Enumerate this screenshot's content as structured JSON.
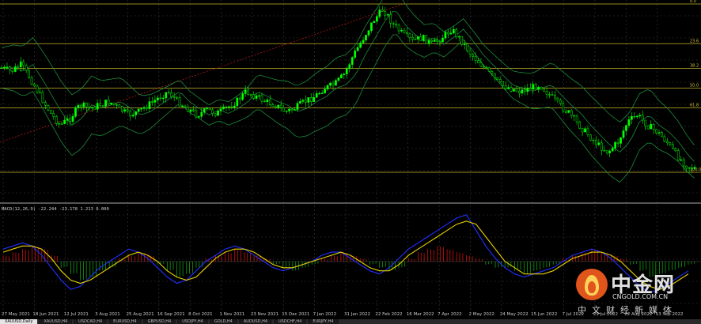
{
  "chart_data": [
    {
      "type": "candlestick",
      "title": "",
      "overlays": [
        "bollinger-bands",
        "fibonacci-retracement",
        "trend-line"
      ],
      "x_ticks": [
        "27 May 2021",
        "18 Jun 2021",
        "12 Jul 2021",
        "3 Aug 2021",
        "25 Aug 2021",
        "16 Sep 2021",
        "8 Oct 2021",
        "1 Nov 2021",
        "23 Nov 2021",
        "15 Dec 2021",
        "7 Jan 2022",
        "31 Jan 2022",
        "22 Feb 2022",
        "16 Mar 2022",
        "7 Apr 2022",
        "2 May 2022",
        "24 May 2022",
        "15 Jun 2022",
        "7 Jul 2022",
        "29 Jul 2022",
        "22 Aug 2022",
        "13 Sep 2022"
      ],
      "fib_levels": [
        {
          "label": "0.0",
          "y": 0.0
        },
        {
          "label": "23.6",
          "y": 23.6
        },
        {
          "label": "38.2",
          "y": 38.2
        },
        {
          "label": "50.0",
          "y": 50.0
        },
        {
          "label": "61.8",
          "y": 61.8
        },
        {
          "label": "100.0",
          "y": 100.0
        }
      ],
      "price_path": [
        [
          0,
          38
        ],
        [
          5,
          40
        ],
        [
          10,
          36
        ],
        [
          15,
          45
        ],
        [
          20,
          55
        ],
        [
          25,
          65
        ],
        [
          30,
          72
        ],
        [
          35,
          68
        ],
        [
          40,
          60
        ],
        [
          45,
          62
        ],
        [
          50,
          60
        ],
        [
          55,
          58
        ],
        [
          60,
          62
        ],
        [
          65,
          66
        ],
        [
          70,
          64
        ],
        [
          75,
          60
        ],
        [
          80,
          56
        ],
        [
          85,
          52
        ],
        [
          90,
          58
        ],
        [
          95,
          62
        ],
        [
          100,
          66
        ],
        [
          105,
          63
        ],
        [
          110,
          65
        ],
        [
          115,
          62
        ],
        [
          120,
          58
        ],
        [
          125,
          52
        ],
        [
          130,
          55
        ],
        [
          135,
          58
        ],
        [
          140,
          60
        ],
        [
          145,
          64
        ],
        [
          150,
          62
        ],
        [
          155,
          58
        ],
        [
          160,
          55
        ],
        [
          165,
          50
        ],
        [
          170,
          48
        ],
        [
          175,
          42
        ],
        [
          180,
          30
        ],
        [
          185,
          20
        ],
        [
          190,
          10
        ],
        [
          195,
          3
        ],
        [
          200,
          12
        ],
        [
          205,
          18
        ],
        [
          210,
          22
        ],
        [
          215,
          20
        ],
        [
          220,
          24
        ],
        [
          225,
          20
        ],
        [
          230,
          15
        ],
        [
          235,
          22
        ],
        [
          240,
          30
        ],
        [
          245,
          36
        ],
        [
          250,
          42
        ],
        [
          255,
          48
        ],
        [
          260,
          50
        ],
        [
          265,
          52
        ],
        [
          270,
          50
        ],
        [
          275,
          48
        ],
        [
          280,
          54
        ],
        [
          285,
          60
        ],
        [
          290,
          65
        ],
        [
          295,
          72
        ],
        [
          300,
          78
        ],
        [
          305,
          84
        ],
        [
          310,
          88
        ],
        [
          315,
          82
        ],
        [
          320,
          70
        ],
        [
          325,
          66
        ],
        [
          330,
          72
        ],
        [
          335,
          76
        ],
        [
          340,
          82
        ],
        [
          345,
          90
        ],
        [
          350,
          96
        ],
        [
          355,
          98
        ]
      ],
      "bands": {
        "upper_offset": 12,
        "lower_offset": 12
      }
    },
    {
      "type": "bar",
      "title": "MACD(12,26,9) -22.244 -23.178 1.213 0.000",
      "histogram": [
        2,
        3,
        4,
        5,
        4,
        2,
        -2,
        -4,
        -6,
        -5,
        -3,
        -2,
        1,
        2,
        3,
        2,
        -1,
        -3,
        -5,
        -4,
        -2,
        1,
        2,
        3,
        4,
        3,
        2,
        1,
        -1,
        -2,
        -3,
        -2,
        -1,
        1,
        2,
        3,
        2,
        1,
        -1,
        -2,
        -3,
        -2,
        1,
        3,
        4,
        5,
        4,
        3,
        2,
        1,
        -1,
        -2,
        -2,
        -3,
        -4,
        -3,
        -2,
        -1,
        1,
        2,
        3,
        4,
        3,
        2,
        1,
        -1,
        -3,
        -5,
        -4,
        -3,
        -2,
        -1
      ],
      "macd_line": [
        4,
        5,
        6,
        5,
        2,
        -2,
        -6,
        -9,
        -8,
        -5,
        -2,
        0,
        2,
        4,
        3,
        1,
        -2,
        -5,
        -7,
        -6,
        -3,
        0,
        2,
        4,
        5,
        4,
        2,
        0,
        -2,
        -3,
        -2,
        -1,
        0,
        2,
        3,
        3,
        1,
        -1,
        -3,
        -4,
        -2,
        1,
        4,
        6,
        8,
        10,
        12,
        14,
        15,
        10,
        5,
        1,
        -2,
        -4,
        -5,
        -4,
        -3,
        -2,
        0,
        2,
        3,
        4,
        3,
        1,
        -2,
        -5,
        -8,
        -10,
        -9,
        -7,
        -5,
        -3
      ],
      "signal_line": [
        3,
        4,
        5,
        5,
        4,
        1,
        -3,
        -6,
        -7,
        -6,
        -4,
        -2,
        0,
        2,
        3,
        2,
        0,
        -3,
        -5,
        -6,
        -5,
        -2,
        1,
        3,
        4,
        4,
        3,
        1,
        -1,
        -2,
        -2,
        -1,
        0,
        1,
        2,
        3,
        2,
        0,
        -2,
        -3,
        -3,
        -1,
        2,
        4,
        6,
        8,
        10,
        12,
        13,
        12,
        8,
        4,
        0,
        -2,
        -4,
        -4,
        -4,
        -3,
        -1,
        1,
        2,
        3,
        3,
        2,
        0,
        -3,
        -6,
        -8,
        -9,
        -8,
        -6,
        -4
      ],
      "y_range": [
        -14,
        16
      ]
    }
  ],
  "tabs": [
    "XAUUSD,Daily",
    "XAUUSD,H4",
    "USDCAD,H4",
    "EURUSD,H4",
    "GBPUSD,H4",
    "USDJPY,H4",
    "GOLD,H4",
    "AUDUSD,H4",
    "USDCHF,H4",
    "EURJPY,H4"
  ],
  "logo": {
    "cn": "中金网",
    "url": "CNGOLD.COM.CN",
    "sub": "中文财经新媒体"
  },
  "colors": {
    "bull": "#00ff00",
    "bear": "#000000",
    "band": "#1e8c3a",
    "fib": "#c8b428",
    "trend": "#b01818",
    "macd_line": "#2030ff",
    "signal": "#e8d200",
    "hist_pos": "#d01010",
    "hist_neg": "#10a010",
    "grid": "#3a3a3a"
  }
}
